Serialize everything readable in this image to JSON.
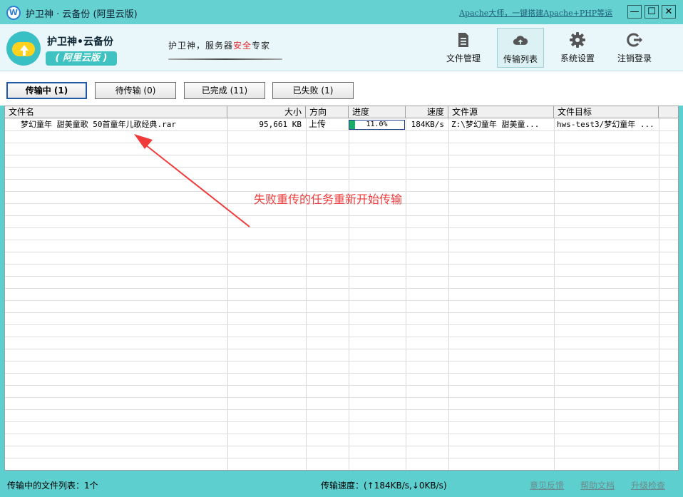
{
  "window": {
    "title": "护卫神 · 云备份 (阿里云版)",
    "promo_link": "Apache大师，一键搭建Apache+PHP等运",
    "buttons": {
      "minimize": "—",
      "maximize": "☐",
      "close": "✕"
    }
  },
  "header": {
    "brand_title": "护卫神•云备份",
    "brand_subtitle": "( 阿里云版 )",
    "slogan_pre": "护卫神，服务器",
    "slogan_highlight": "安全",
    "slogan_post": "专家",
    "toolbar": [
      {
        "label": "文件管理",
        "icon": "document-icon"
      },
      {
        "label": "传输列表",
        "icon": "cloud-icon"
      },
      {
        "label": "系统设置",
        "icon": "gear-icon"
      },
      {
        "label": "注销登录",
        "icon": "logout-icon"
      }
    ]
  },
  "tabs": [
    {
      "label": "传输中 (1)",
      "active": true
    },
    {
      "label": "待传输 (0)",
      "active": false
    },
    {
      "label": "已完成 (11)",
      "active": false
    },
    {
      "label": "已失败 (1)",
      "active": false
    }
  ],
  "table": {
    "columns": [
      "文件名",
      "大小",
      "方向",
      "进度",
      "速度",
      "文件源",
      "文件目标"
    ],
    "rows": [
      {
        "filename": "梦幻童年 甜美童歌 50首童年儿歌经典.rar",
        "size": "95,661 KB",
        "direction": "上传",
        "progress_text": "11.0%",
        "progress": 0.11,
        "speed": "184KB/s",
        "source": "Z:\\梦幻童年 甜美童...",
        "target": "hws-test3/梦幻童年 ..."
      }
    ]
  },
  "annotation": {
    "text": "失败重传的任务重新开始传输",
    "color": "#f03a3a"
  },
  "status": {
    "left": "传输中的文件列表：1个",
    "speed": "传输速度：(↑184KB/s,↓0KB/s)",
    "links": [
      "意见反馈",
      "帮助文档",
      "升级检查"
    ]
  },
  "colors": {
    "titlebar": "#66d1d1",
    "accent": "#3ec2c2",
    "progress_fill": "#1bab6b"
  }
}
